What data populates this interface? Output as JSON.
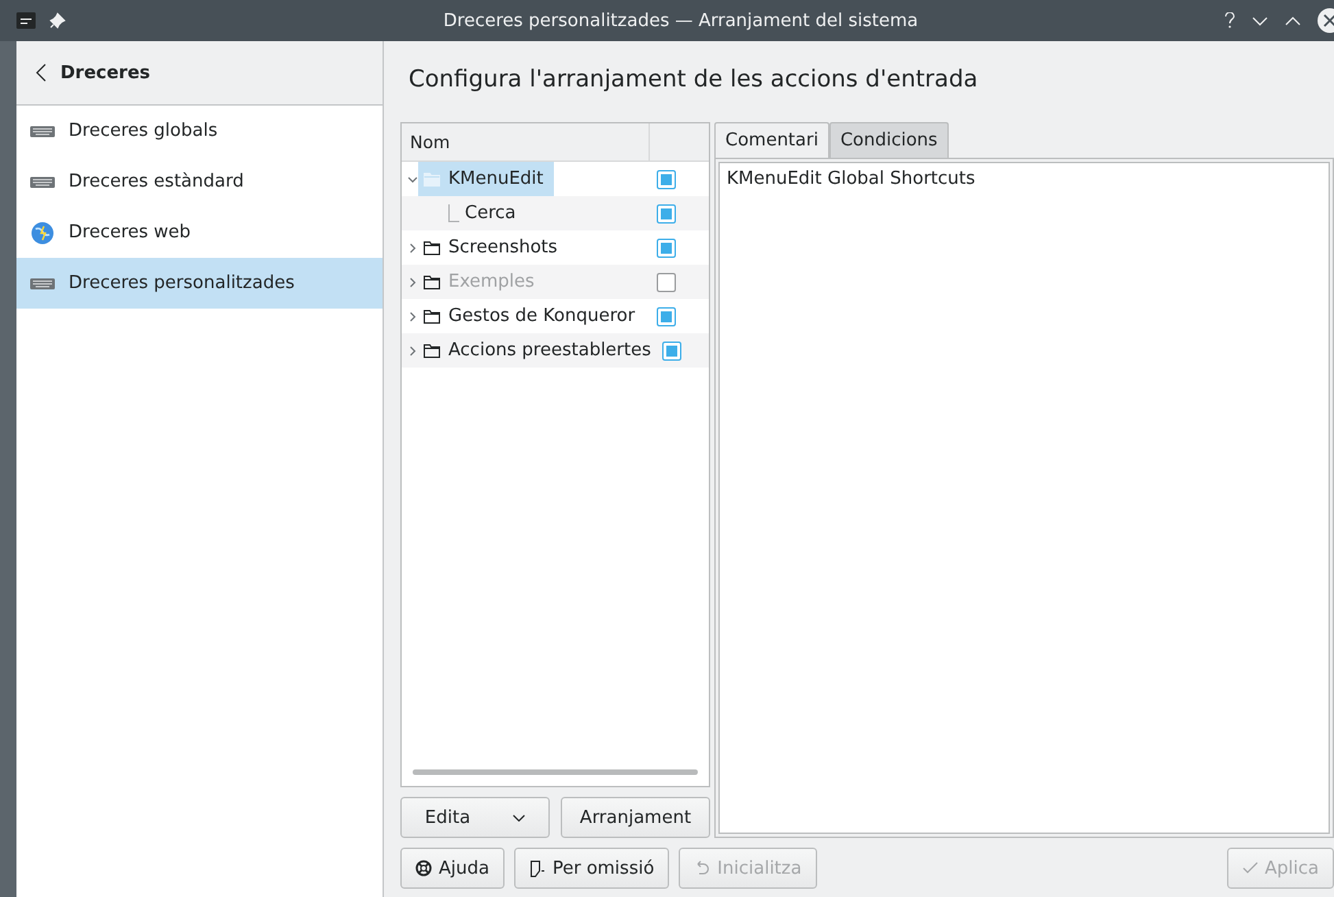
{
  "window": {
    "title": "Dreceres personalitzades — Arranjament del sistema"
  },
  "sidebar": {
    "back_label": "Dreceres",
    "items": [
      {
        "label": "Dreceres globals",
        "selected": false
      },
      {
        "label": "Dreceres estàndard",
        "selected": false
      },
      {
        "label": "Dreceres web",
        "selected": false
      },
      {
        "label": "Dreceres personalitzades",
        "selected": true
      }
    ]
  },
  "page_title": "Configura l'arranjament de les accions d'entrada",
  "tree": {
    "columns": [
      "Nom"
    ],
    "rows": [
      {
        "label": "KMenuEdit",
        "kind": "folder",
        "expanded": true,
        "selected": true,
        "checked": true,
        "disabled": false,
        "children": [
          {
            "label": "Cerca",
            "kind": "action",
            "selected": false,
            "checked": true,
            "disabled": false
          }
        ]
      },
      {
        "label": "Screenshots",
        "kind": "folder",
        "expanded": false,
        "selected": false,
        "checked": true,
        "disabled": false
      },
      {
        "label": "Exemples",
        "kind": "folder",
        "expanded": false,
        "selected": false,
        "checked": false,
        "disabled": true
      },
      {
        "label": "Gestos de Konqueror",
        "kind": "folder",
        "expanded": false,
        "selected": false,
        "checked": true,
        "disabled": false
      },
      {
        "label": "Accions preestablertes",
        "kind": "folder",
        "expanded": false,
        "selected": false,
        "checked": true,
        "disabled": false
      }
    ]
  },
  "tree_buttons": [
    {
      "label": "Edita",
      "kind": "menu"
    },
    {
      "label": "Arranjament",
      "kind": "plain"
    }
  ],
  "tabs": [
    {
      "label": "Comentari",
      "selected": true
    },
    {
      "label": "Condicions",
      "selected": false
    }
  ],
  "comment": "KMenuEdit Global Shortcuts",
  "footer_buttons": [
    {
      "label": "Ajuda",
      "disabled": false
    },
    {
      "label": "Per omissió",
      "disabled": false
    },
    {
      "label": "Inicialitza",
      "disabled": true
    },
    {
      "label": "Aplica",
      "disabled": true
    }
  ]
}
